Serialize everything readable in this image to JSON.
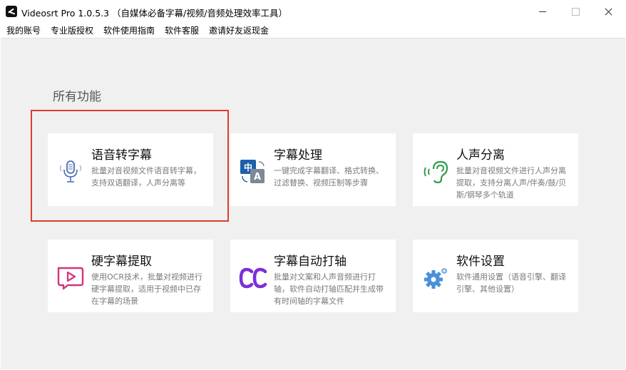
{
  "window": {
    "title": "Videosrt Pro 1.0.5.3 （自媒体必备字幕/视频/音频处理效率工具）"
  },
  "menu": [
    "我的账号",
    "专业版授权",
    "软件使用指南",
    "软件客服",
    "邀请好友返现金"
  ],
  "section_title": "所有功能",
  "cards": [
    {
      "title": "语音转字幕",
      "desc": "批量对音视频文件语音转字幕，支持双语翻译，人声分离等",
      "icon": "microphone-icon"
    },
    {
      "title": "字幕处理",
      "desc": "一键完成字幕翻译、格式转换、过滤替换、视频压制等步骤",
      "icon": "translate-icon"
    },
    {
      "title": "人声分离",
      "desc": "批量对音视频文件进行人声分离提取，支持分离人声/伴奏/鼓/贝斯/钢琴多个轨道",
      "icon": "ear-icon"
    },
    {
      "title": "硬字幕提取",
      "desc": "使用OCR技术，批量对视频进行硬字幕提取，适用于视频中已存在字幕的场景",
      "icon": "play-screen-icon"
    },
    {
      "title": "字幕自动打轴",
      "desc": "批量对文案和人声音频进行打轴，软件自动打轴匹配并生成带有时间轴的字幕文件",
      "icon": "cc-icon"
    },
    {
      "title": "软件设置",
      "desc": "软件通用设置（语音引擎、翻译引擎、其他设置）",
      "icon": "gear-icon"
    }
  ],
  "colors": {
    "highlight": "#e23a2c",
    "microphone": "#4a6fb5",
    "translate_blue": "#1d5fa8",
    "ear": "#2f9a4a",
    "pink": "#d6337a",
    "cc": "#7b2fd9",
    "gear": "#4a90d9"
  }
}
